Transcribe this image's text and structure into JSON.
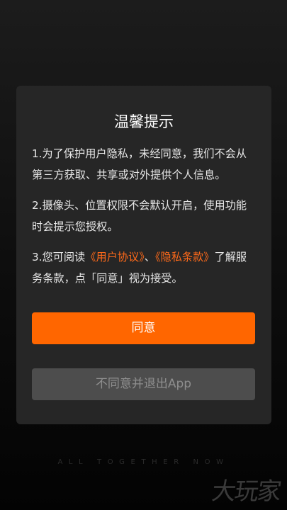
{
  "dialog": {
    "title": "温馨提示",
    "paragraph1": "1.为了保护用户隐私，未经同意，我们不会从第三方获取、共享或对外提供个人信息。",
    "paragraph2": "2.摄像头、位置权限不会默认开启，使用功能时会提示您授权。",
    "paragraph3": {
      "prefix": "3.您可阅读",
      "user_agreement_link": "《用户协议》",
      "separator": "、",
      "privacy_terms_link": "《隐私条款》",
      "suffix": "了解服务条款，点「同意」视为接受。"
    },
    "agree_label": "同意",
    "disagree_label": "不同意并退出App"
  },
  "background": {
    "slogan": "ALL TOGETHER NOW",
    "logo_text": "大玩家"
  },
  "colors": {
    "accent": "#ff6600",
    "link": "#ff6a1a",
    "dialog_bg": "#262626",
    "disabled_button": "#4d4d4d"
  }
}
